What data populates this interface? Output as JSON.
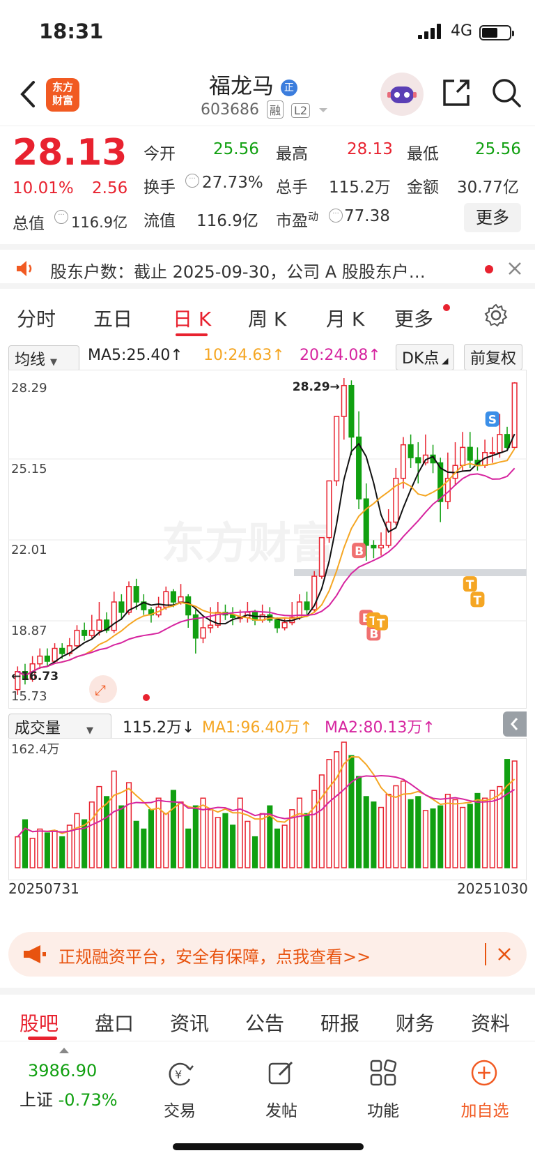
{
  "status": {
    "time": "18:31",
    "network": "4G"
  },
  "header": {
    "title": "福龙马",
    "code": "603686",
    "tag1": "融",
    "tag2": "L2",
    "logo_line1": "东方",
    "logo_line2": "财富",
    "badge": "正"
  },
  "quote": {
    "price": "28.13",
    "change_pct": "10.01%",
    "change": "2.56",
    "open_label": "今开",
    "open": "25.56",
    "high_label": "最高",
    "high": "28.13",
    "low_label": "最低",
    "low": "25.56",
    "turnover_label": "换手",
    "turnover": "27.73%",
    "volume_label": "总手",
    "volume": "115.2万",
    "amount_label": "金额",
    "amount": "30.77亿",
    "mktcap_label": "总值",
    "mktcap": "116.9亿",
    "float_label": "流值",
    "float": "116.9亿",
    "pe_label": "市盈",
    "pe_sup": "动",
    "pe": "77.38",
    "more": "更多"
  },
  "notice": {
    "text": "股东户数：截止 2025-09-30，公司 A 股股东户…"
  },
  "tabs": [
    "分时",
    "五日",
    "日 K",
    "周 K",
    "月 K",
    "更多"
  ],
  "ma": {
    "selector": "均线",
    "ma5": "MA5:25.40↑",
    "ma10": "10:24.63↑",
    "ma20": "20:24.08↑",
    "dk": "DK点",
    "fq": "前复权"
  },
  "volume": {
    "selector": "成交量",
    "value": "115.2万↓",
    "ma1": "MA1:96.40万↑",
    "ma2": "MA2:80.13万↑",
    "max_label": "162.4万",
    "date_start": "20250731",
    "date_end": "20251030"
  },
  "chart_data": {
    "type": "candlestick",
    "y_ticks": [
      "28.29",
      "25.15",
      "22.01",
      "18.87",
      "15.73"
    ],
    "high_marker": "28.29→",
    "low_marker": "←16.73",
    "ylim": [
      15.73,
      28.29
    ],
    "signals": [
      "B",
      "B",
      "B",
      "B",
      "T",
      "T",
      "T",
      "T",
      "S"
    ],
    "candles": [
      [
        16.2,
        16.9,
        16.0,
        17.1
      ],
      [
        16.9,
        16.6,
        16.4,
        17.2
      ],
      [
        16.6,
        17.2,
        16.5,
        17.5
      ],
      [
        17.2,
        17.5,
        17.0,
        17.8
      ],
      [
        17.5,
        17.3,
        17.1,
        17.8
      ],
      [
        17.3,
        17.8,
        17.2,
        18.0
      ],
      [
        17.8,
        17.6,
        17.4,
        18.0
      ],
      [
        17.6,
        17.9,
        17.5,
        18.2
      ],
      [
        17.9,
        18.5,
        17.8,
        18.7
      ],
      [
        18.5,
        18.3,
        18.1,
        18.8
      ],
      [
        18.3,
        18.5,
        18.2,
        19.1
      ],
      [
        18.5,
        18.9,
        18.3,
        19.6
      ],
      [
        18.9,
        18.5,
        18.4,
        19.2
      ],
      [
        18.5,
        19.6,
        18.4,
        20.0
      ],
      [
        19.6,
        19.2,
        18.9,
        19.9
      ],
      [
        19.2,
        20.2,
        19.1,
        20.4
      ],
      [
        20.2,
        19.6,
        19.3,
        20.5
      ],
      [
        19.6,
        19.3,
        19.1,
        19.9
      ],
      [
        19.3,
        19.1,
        18.8,
        19.4
      ],
      [
        19.1,
        19.4,
        19.0,
        19.8
      ],
      [
        19.4,
        20.0,
        19.3,
        20.2
      ],
      [
        20.0,
        19.6,
        19.4,
        20.1
      ],
      [
        19.6,
        19.8,
        19.5,
        20.3
      ],
      [
        19.8,
        19.1,
        18.6,
        19.9
      ],
      [
        19.1,
        18.2,
        17.6,
        19.3
      ],
      [
        18.2,
        18.6,
        18.0,
        19.0
      ],
      [
        18.6,
        18.7,
        18.4,
        19.4
      ],
      [
        18.7,
        19.2,
        18.6,
        19.6
      ],
      [
        19.2,
        19.1,
        18.9,
        19.5
      ],
      [
        19.1,
        19.0,
        18.7,
        19.4
      ],
      [
        19.0,
        19.0,
        18.8,
        19.3
      ],
      [
        19.0,
        19.2,
        18.8,
        19.6
      ],
      [
        19.2,
        18.9,
        18.7,
        19.3
      ],
      [
        18.9,
        19.1,
        18.8,
        19.5
      ],
      [
        19.1,
        18.9,
        18.8,
        19.4
      ],
      [
        18.9,
        18.6,
        18.4,
        19.0
      ],
      [
        18.6,
        18.8,
        18.5,
        19.0
      ],
      [
        18.8,
        19.0,
        18.7,
        19.6
      ],
      [
        19.0,
        19.6,
        18.9,
        19.9
      ],
      [
        19.6,
        19.3,
        19.1,
        20.0
      ],
      [
        19.3,
        20.6,
        19.2,
        20.8
      ],
      [
        20.6,
        22.1,
        20.5,
        22.1
      ],
      [
        22.1,
        24.3,
        21.9,
        24.3
      ],
      [
        24.3,
        26.8,
        24.1,
        26.8
      ],
      [
        26.8,
        28.0,
        25.9,
        28.29
      ],
      [
        28.0,
        26.0,
        25.3,
        28.2
      ],
      [
        26.0,
        23.6,
        23.2,
        27.0
      ],
      [
        23.6,
        21.8,
        21.2,
        24.2
      ],
      [
        21.8,
        21.7,
        21.3,
        22.0
      ],
      [
        21.7,
        21.8,
        21.4,
        22.3
      ],
      [
        21.8,
        22.7,
        21.7,
        23.2
      ],
      [
        22.7,
        24.4,
        22.6,
        24.8
      ],
      [
        24.4,
        25.7,
        24.0,
        26.0
      ],
      [
        25.7,
        25.2,
        24.8,
        26.1
      ],
      [
        25.2,
        25.0,
        24.2,
        25.8
      ],
      [
        25.0,
        25.3,
        24.9,
        26.1
      ],
      [
        25.3,
        25.0,
        24.6,
        25.7
      ],
      [
        25.0,
        23.5,
        22.7,
        25.2
      ],
      [
        23.5,
        24.4,
        23.2,
        25.4
      ],
      [
        24.4,
        24.9,
        24.1,
        25.8
      ],
      [
        24.9,
        25.6,
        24.7,
        26.2
      ],
      [
        25.6,
        25.1,
        24.8,
        26.2
      ],
      [
        25.1,
        24.9,
        24.7,
        25.6
      ],
      [
        24.9,
        25.4,
        24.8,
        25.9
      ],
      [
        25.4,
        25.4,
        25.0,
        26.0
      ],
      [
        25.4,
        26.1,
        25.2,
        26.9
      ],
      [
        26.1,
        25.6,
        25.5,
        26.4
      ],
      [
        25.6,
        28.1,
        25.56,
        28.13
      ]
    ],
    "volumes": [
      40,
      62,
      38,
      50,
      45,
      48,
      40,
      55,
      70,
      62,
      85,
      105,
      92,
      125,
      80,
      110,
      60,
      50,
      75,
      90,
      70,
      100,
      85,
      50,
      80,
      90,
      75,
      65,
      70,
      55,
      90,
      60,
      40,
      70,
      80,
      50,
      55,
      75,
      90,
      70,
      100,
      120,
      140,
      150,
      162.4,
      145,
      118,
      92,
      85,
      78,
      95,
      106,
      112,
      88,
      92,
      74,
      76,
      80,
      95,
      88,
      78,
      82,
      96,
      90,
      100,
      105,
      140,
      138
    ]
  },
  "banner": {
    "text": "正规融资平台，安全有保障，点我查看>>"
  },
  "bottom_tabs": [
    "股吧",
    "盘口",
    "资讯",
    "公告",
    "研报",
    "财务",
    "资料"
  ],
  "nav": {
    "index_value": "3986.90",
    "index_name": "上证",
    "index_change": "-0.73%",
    "items": [
      "交易",
      "发帖",
      "功能",
      "加自选"
    ]
  },
  "colors": {
    "up": "#e8222f",
    "down": "#11a011",
    "ma5": "#111111",
    "ma10": "#f5a623",
    "ma20": "#d6249f",
    "accent": "#f15a22"
  }
}
